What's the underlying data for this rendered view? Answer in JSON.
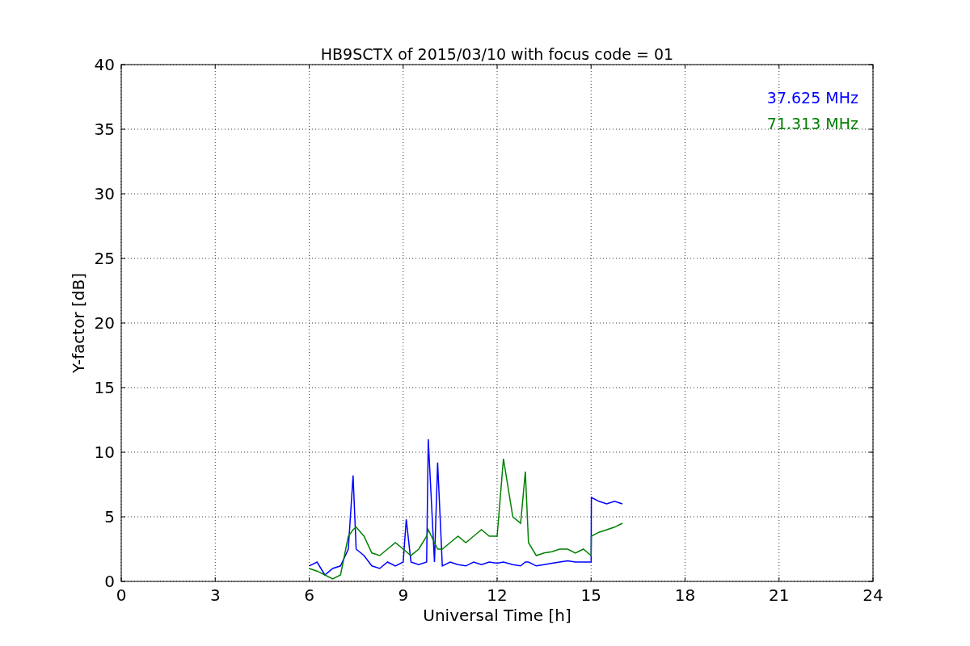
{
  "chart_data": {
    "type": "line",
    "title": "HB9SCTX of 2015/03/10 with focus code = 01",
    "xlabel": "Universal Time [h]",
    "ylabel": "Y-factor [dB]",
    "x": [
      6,
      6.25,
      6.5,
      6.75,
      7,
      7.25,
      7.4,
      7.5,
      7.75,
      8,
      8.25,
      8.5,
      8.75,
      9,
      9.1,
      9.25,
      9.5,
      9.75,
      9.8,
      10,
      10.1,
      10.25,
      10.5,
      10.75,
      11,
      11.25,
      11.5,
      11.75,
      12,
      12.2,
      12.5,
      12.75,
      12.9,
      13,
      13.25,
      13.5,
      13.75,
      14,
      14.25,
      14.5,
      14.75,
      15,
      15.01,
      15.25,
      15.5,
      15.75,
      16
    ],
    "series": [
      {
        "name": "37.625 MHz",
        "color": "#0000ff",
        "values": [
          1.2,
          1.5,
          0.5,
          1.0,
          1.2,
          2.5,
          8.2,
          2.5,
          2.0,
          1.2,
          1.0,
          1.5,
          1.2,
          1.5,
          4.8,
          1.5,
          1.3,
          1.5,
          11.0,
          1.5,
          9.2,
          1.2,
          1.5,
          1.3,
          1.2,
          1.5,
          1.3,
          1.5,
          1.4,
          1.5,
          1.3,
          1.2,
          1.5,
          1.5,
          1.2,
          1.3,
          1.4,
          1.5,
          1.6,
          1.5,
          1.5,
          1.5,
          6.5,
          6.2,
          6.0,
          6.2,
          6.0
        ]
      },
      {
        "name": "71.313 MHz",
        "color": "#008000",
        "values": [
          1.0,
          0.8,
          0.5,
          0.2,
          0.5,
          3.5,
          4.0,
          4.2,
          3.5,
          2.2,
          2.0,
          2.5,
          3.0,
          2.5,
          2.3,
          2.0,
          2.5,
          3.5,
          4.0,
          3.0,
          2.5,
          2.5,
          3.0,
          3.5,
          3.0,
          3.5,
          4.0,
          3.5,
          3.5,
          9.5,
          5.0,
          4.5,
          8.5,
          3.0,
          2.0,
          2.2,
          2.3,
          2.5,
          2.5,
          2.2,
          2.5,
          2.0,
          3.5,
          3.8,
          4.0,
          4.2,
          4.5
        ]
      }
    ],
    "grid": true,
    "xlim": [
      0,
      24
    ],
    "ylim": [
      0,
      40
    ],
    "xticks": [
      0,
      3,
      6,
      9,
      12,
      15,
      18,
      21,
      24
    ],
    "yticks": [
      0,
      5,
      10,
      15,
      20,
      25,
      30,
      35,
      40
    ]
  }
}
